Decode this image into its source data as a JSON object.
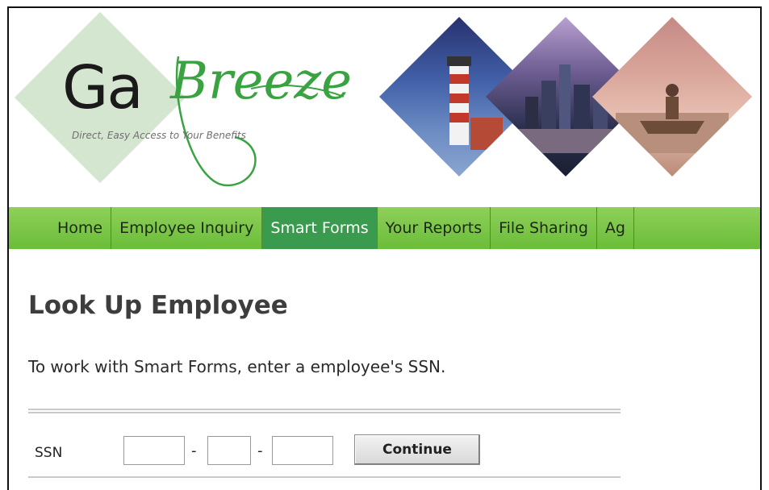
{
  "logo": {
    "text_ga": "Ga",
    "text_breeze": "Breeze",
    "tagline": "Direct, Easy Access to Your Benefits"
  },
  "nav": {
    "items": [
      {
        "label": "Home",
        "active": false
      },
      {
        "label": "Employee Inquiry",
        "active": false
      },
      {
        "label": "Smart Forms",
        "active": true
      },
      {
        "label": "Your Reports",
        "active": false
      },
      {
        "label": "File Sharing",
        "active": false
      },
      {
        "label": "Ag",
        "active": false
      }
    ]
  },
  "page": {
    "title": "Look Up Employee",
    "instructions": "To work with Smart Forms, enter a employee's SSN."
  },
  "form": {
    "ssn_label": "SSN",
    "ssn_part1": "",
    "ssn_part2": "",
    "ssn_part3": "",
    "separator": "-",
    "continue_label": "Continue"
  },
  "colors": {
    "nav_green": "#7cc84a",
    "nav_active": "#3a9b4e",
    "logo_green": "#3aa341",
    "logo_diamond": "#d4e6cf"
  }
}
